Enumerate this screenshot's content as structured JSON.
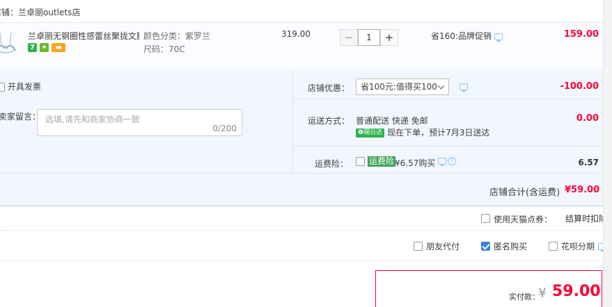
{
  "shop": {
    "header_label": "店铺：兰卓丽outlets店"
  },
  "item": {
    "title": "兰卓丽无钢圈性感蕾丝聚拢文胸...",
    "color_label": "颜色分类：紫罗兰",
    "size_label": "尺码：70C",
    "original_price": "319.00",
    "quantity": "1",
    "qty_minus": "−",
    "qty_plus": "+",
    "promotion": "省160:品牌促销",
    "subtotal": "159.00",
    "badges": [
      "7",
      "✦",
      "▬"
    ]
  },
  "invoice": {
    "label": "开具发票",
    "checked": false
  },
  "message": {
    "label": "卖家留言：",
    "placeholder": "选填,请先和商家协商一致",
    "counter": "0/200"
  },
  "shop_coupon": {
    "label": "店铺优惠：",
    "selected": "省100元:值得买100",
    "amount": "-100.00"
  },
  "shipping": {
    "label": "运送方式：",
    "method": "普通配送 快递 免邮",
    "badge": "❶隔日达",
    "eta": "现在下单，预计7月3日送达",
    "amount": "0.00"
  },
  "insurance": {
    "label": "运费险：",
    "tag": "运费险",
    "price": "¥6.57购买",
    "amount": "6.57"
  },
  "shop_total": {
    "label": "店铺合计(含运费)",
    "amount": "¥59.00"
  },
  "points": {
    "label": "使用天猫点券：",
    "right_text": "结算时扣除"
  },
  "payment_options": [
    {
      "label": "朋友代付",
      "checked": false
    },
    {
      "label": "匿名购买",
      "checked": true
    },
    {
      "label": "花呗分期",
      "checked": false
    }
  ],
  "final": {
    "label": "实付款：",
    "currency": "¥",
    "amount": "59.00"
  },
  "colors": {
    "accent_red": "#ff0036",
    "panel_blue": "#f2f7ff",
    "link_blue": "#8fc4f0"
  }
}
